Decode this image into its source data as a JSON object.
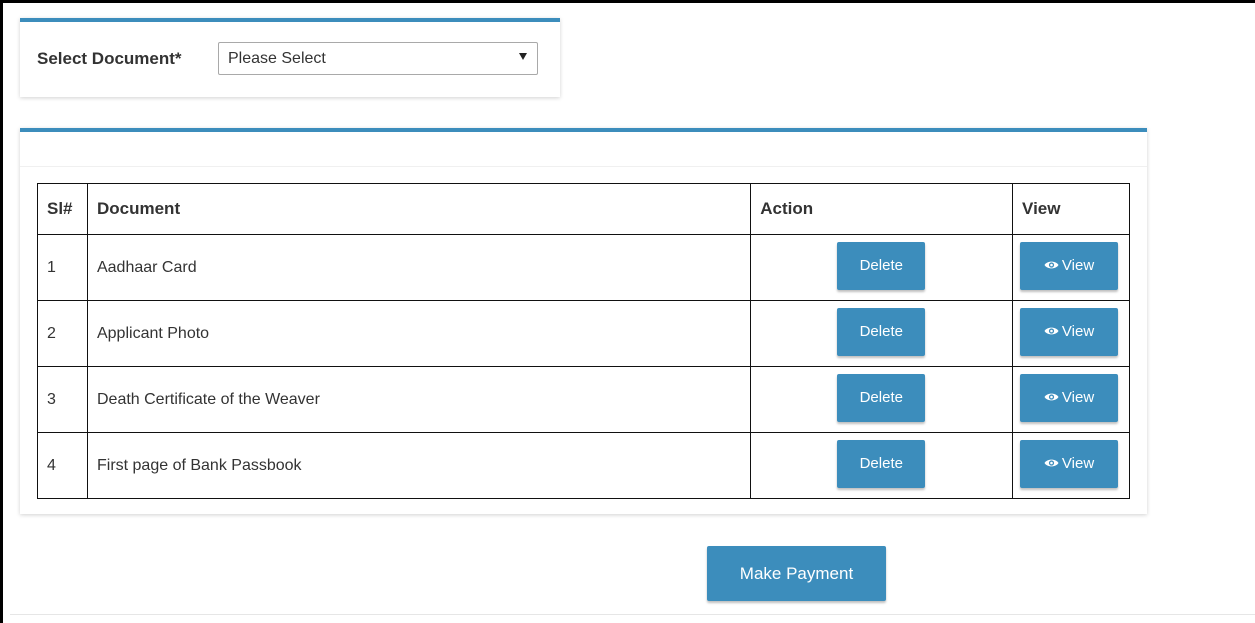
{
  "form": {
    "select_label": "Select Document*",
    "select_value": "Please Select"
  },
  "table": {
    "headers": {
      "sl": "Sl#",
      "document": "Document",
      "action": "Action",
      "view": "View"
    },
    "rows": [
      {
        "sl": "1",
        "document": "Aadhaar Card",
        "delete_label": "Delete",
        "view_label": "View"
      },
      {
        "sl": "2",
        "document": "Applicant Photo",
        "delete_label": "Delete",
        "view_label": "View"
      },
      {
        "sl": "3",
        "document": "Death Certificate of the Weaver",
        "delete_label": "Delete",
        "view_label": "View"
      },
      {
        "sl": "4",
        "document": "First page of Bank Passbook",
        "delete_label": "Delete",
        "view_label": "View"
      }
    ]
  },
  "actions": {
    "make_payment_label": "Make Payment"
  },
  "icons": {
    "view_button_icon": "eye-icon",
    "select_caret_icon": "caret-down-icon"
  },
  "colors": {
    "accent": "#3c8dbc",
    "button_text": "#ffffff",
    "table_border": "#111111"
  }
}
